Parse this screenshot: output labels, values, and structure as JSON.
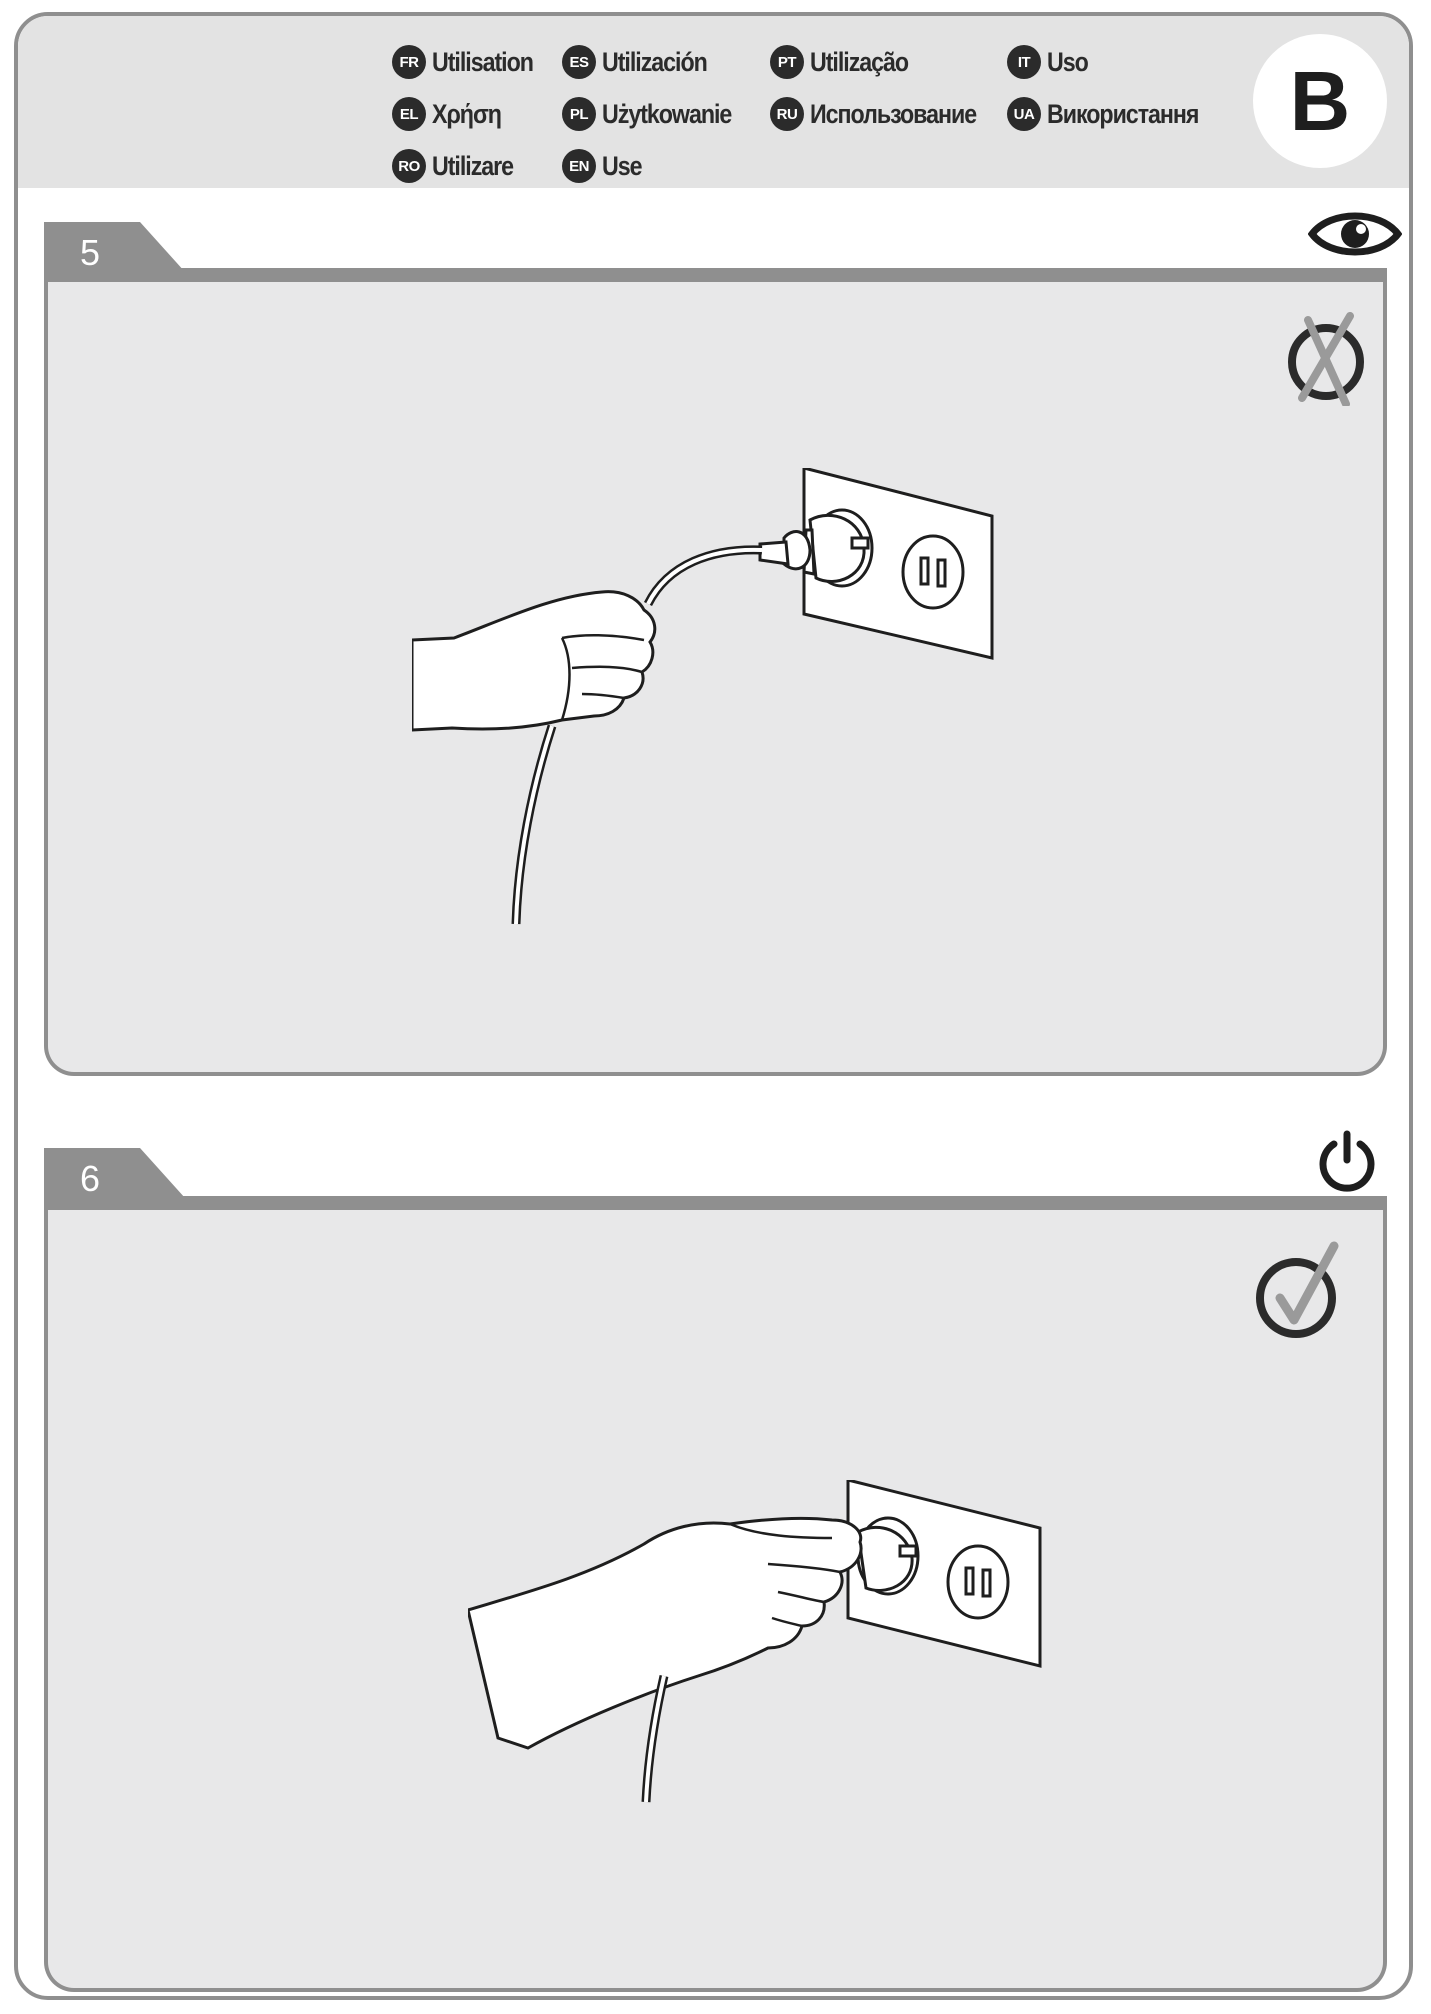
{
  "header": {
    "section_letter": "B",
    "languages": [
      {
        "code": "FR",
        "label": "Utilisation"
      },
      {
        "code": "ES",
        "label": "Utilización"
      },
      {
        "code": "PT",
        "label": "Utilização"
      },
      {
        "code": "IT",
        "label": "Uso"
      },
      {
        "code": "EL",
        "label": "Χρήση"
      },
      {
        "code": "PL",
        "label": "Użytkowanie"
      },
      {
        "code": "RU",
        "label": "Использование"
      },
      {
        "code": "UA",
        "label": "Використання"
      },
      {
        "code": "RO",
        "label": "Utilizare"
      },
      {
        "code": "EN",
        "label": "Use"
      }
    ]
  },
  "steps": [
    {
      "number": "5",
      "header_icon": "eye-icon",
      "status_icon": "cross-mark-icon",
      "illustration": "hand-holding-cord-near-outlet"
    },
    {
      "number": "6",
      "header_icon": "power-icon",
      "status_icon": "check-mark-icon",
      "illustration": "hand-pulling-plug-from-outlet"
    }
  ],
  "colors": {
    "header_bg": "#e3e3e3",
    "panel_bg": "#e8e8e9",
    "frame": "#8f8f8f",
    "ink": "#2b2b2b"
  }
}
